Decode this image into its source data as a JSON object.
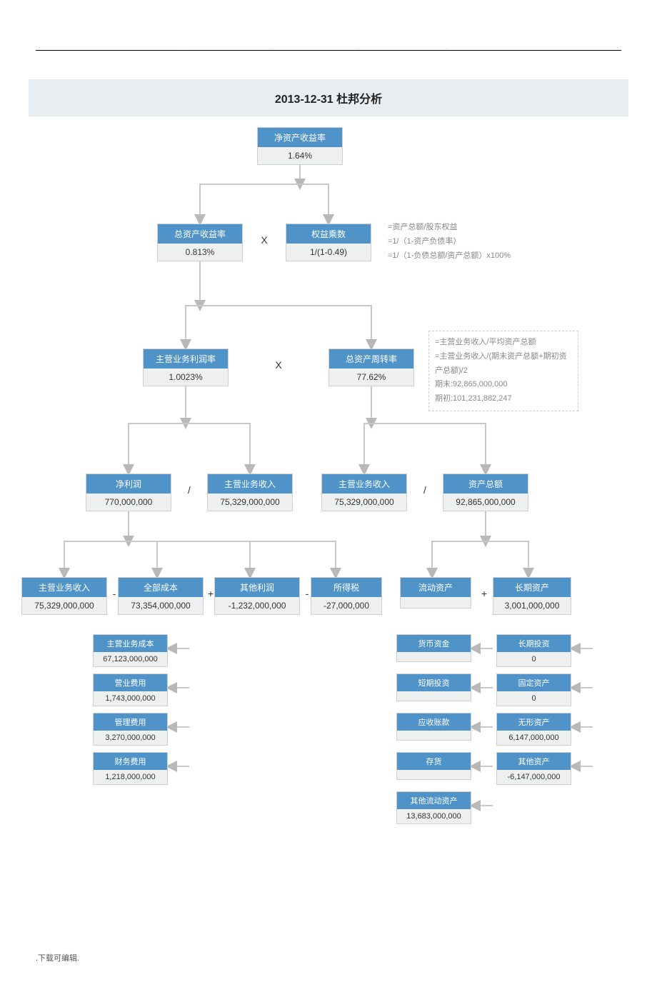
{
  "header": {
    "title": "2013-12-31  杜邦分析"
  },
  "nodes": {
    "roe": {
      "label": "净资产收益率",
      "value": "1.64%"
    },
    "roa": {
      "label": "总资产收益率",
      "value": "0.813%"
    },
    "eqmult": {
      "label": "权益乘数",
      "value": "1/(1-0.49)"
    },
    "opmargin": {
      "label": "主营业务利润率",
      "value": "1.0023%"
    },
    "turnover": {
      "label": "总资产周转率",
      "value": "77.62%"
    },
    "netprofit": {
      "label": "净利润",
      "value": "770,000,000"
    },
    "revenue1": {
      "label": "主营业务收入",
      "value": "75,329,000,000"
    },
    "revenue2": {
      "label": "主营业务收入",
      "value": "75,329,000,000"
    },
    "totalasset": {
      "label": "资产总额",
      "value": "92,865,000,000"
    },
    "revenue3": {
      "label": "主营业务收入",
      "value": "75,329,000,000"
    },
    "allcost": {
      "label": "全部成本",
      "value": "73,354,000,000"
    },
    "otherprof": {
      "label": "其他利润",
      "value": "-1,232,000,000"
    },
    "tax": {
      "label": "所得税",
      "value": "-27,000,000"
    },
    "curasset": {
      "label": "流动资产",
      "value": ""
    },
    "ltasset": {
      "label": "长期资产",
      "value": "3,001,000,000"
    },
    "cogs": {
      "label": "主营业务成本",
      "value": "67,123,000,000"
    },
    "sellexp": {
      "label": "营业费用",
      "value": "1,743,000,000"
    },
    "mgmtexp": {
      "label": "管理费用",
      "value": "3,270,000,000"
    },
    "finexp": {
      "label": "财务费用",
      "value": "1,218,000,000"
    },
    "cash": {
      "label": "货币资金",
      "value": ""
    },
    "stinv": {
      "label": "短期投资",
      "value": ""
    },
    "ar": {
      "label": "应收账款",
      "value": ""
    },
    "inv": {
      "label": "存货",
      "value": ""
    },
    "othercur": {
      "label": "其他流动资产",
      "value": "13,683,000,000"
    },
    "ltinv": {
      "label": "长期投资",
      "value": "0"
    },
    "fixed": {
      "label": "固定资产",
      "value": "0"
    },
    "intang": {
      "label": "无形资产",
      "value": "6,147,000,000"
    },
    "otherast": {
      "label": "其他资产",
      "value": "-6,147,000,000"
    }
  },
  "notes": {
    "eqmult": {
      "l1": "=资产总额/股东权益",
      "l2": "=1/（1-资产负债率）",
      "l3": "=1/（1-负债总额/资产总额）x100%"
    },
    "turnover": {
      "l1": "=主营业务收入/平均资产总额",
      "l2": "=主营业务收入/(期末资产总额+期初资产总额)/2",
      "l3": "期末:92,865,000,000",
      "l4": "期初:101,231,882,247"
    }
  },
  "ops": {
    "x1": "X",
    "x2": "X",
    "d1": "/",
    "d2": "/",
    "m1": "-",
    "p1": "+",
    "m2": "-",
    "p2": "+"
  },
  "footer": ".下载可编辑."
}
